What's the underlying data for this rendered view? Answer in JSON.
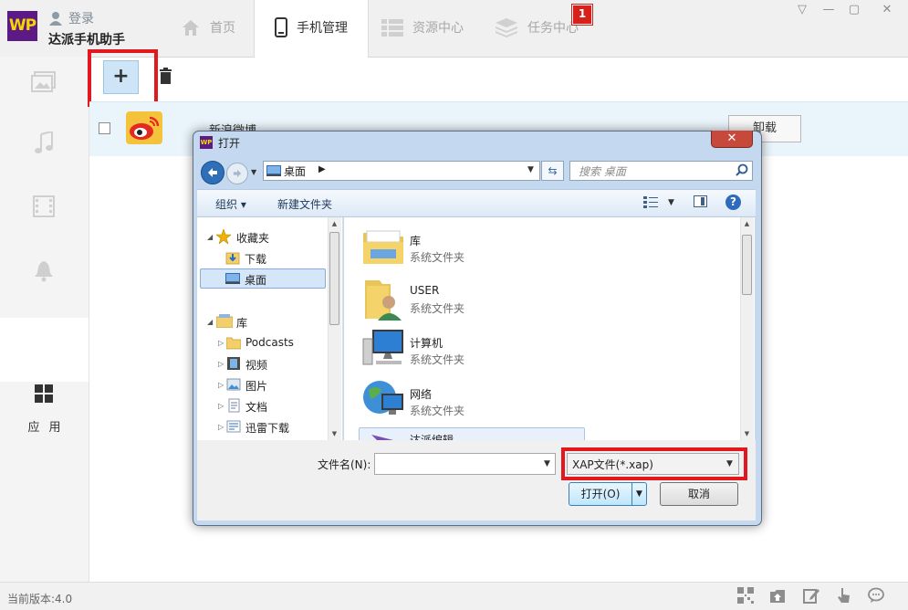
{
  "app": {
    "logo_text": "WP",
    "login_label": "登录",
    "name": "达派手机助手"
  },
  "nav": {
    "tabs": [
      {
        "label": "首页",
        "active": false
      },
      {
        "label": "手机管理",
        "active": true
      },
      {
        "label": "资源中心",
        "active": false
      },
      {
        "label": "任务中心",
        "active": false
      }
    ],
    "task_badge": "1"
  },
  "window_controls": [
    "▽",
    "—",
    "▢",
    "✕"
  ],
  "sidebar": {
    "items": [
      "photos-icon",
      "music-icon",
      "video-icon",
      "ringtone-icon",
      "contacts-icon",
      "apps-icon"
    ],
    "apps_label": "应用"
  },
  "toolbar": {
    "add_label": "+"
  },
  "app_list": {
    "rows": [
      {
        "name": "新浪微博",
        "action": "卸载"
      }
    ]
  },
  "status": {
    "version": "当前版本:4.0"
  },
  "dialog": {
    "title": "打开",
    "close_label": "✕",
    "address": "桌面",
    "search_placeholder": "搜索 桌面",
    "organize_label": "组织 ▾",
    "new_folder_label": "新建文件夹",
    "tree": {
      "favorites": "收藏夹",
      "downloads": "下载",
      "desktop": "桌面",
      "libraries": "库",
      "podcasts": "Podcasts",
      "videos": "视频",
      "pictures": "图片",
      "documents": "文档",
      "thunder": "迅雷下载"
    },
    "files": [
      {
        "name": "库",
        "type": "系统文件夹"
      },
      {
        "name": "USER",
        "type": "系统文件夹"
      },
      {
        "name": "计算机",
        "type": "系统文件夹"
      },
      {
        "name": "网络",
        "type": "系统文件夹"
      },
      {
        "name": "达派编辑",
        "type": ""
      }
    ],
    "filename_label": "文件名(N):",
    "filename_value": "",
    "filetype_value": "XAP文件(*.xap)",
    "open_label": "打开(O)",
    "cancel_label": "取消"
  }
}
